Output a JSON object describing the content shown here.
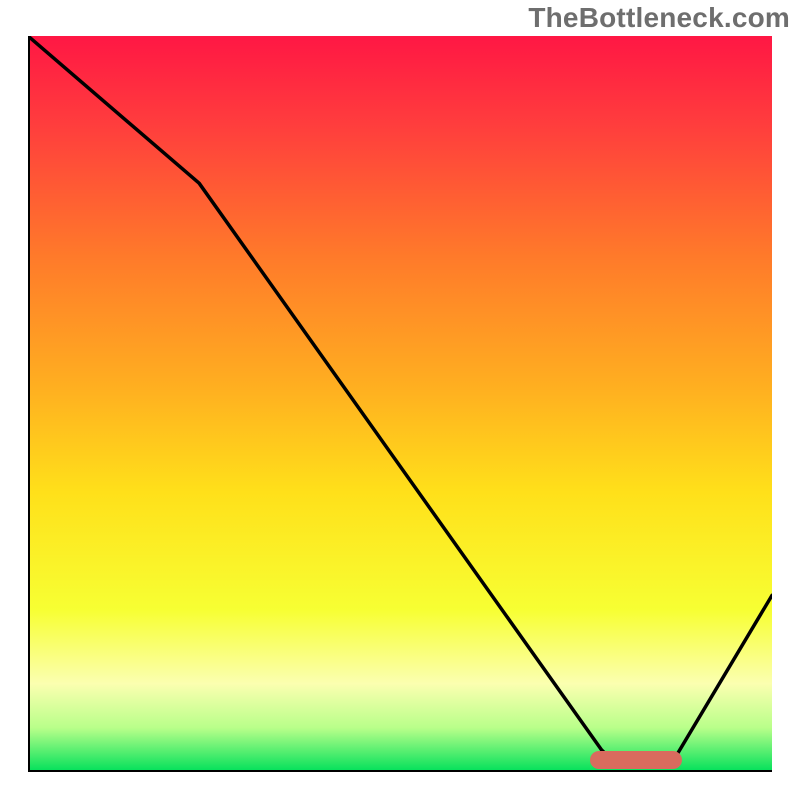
{
  "watermark": "TheBottleneck.com",
  "chart_data": {
    "type": "line",
    "title": "",
    "xlabel": "",
    "ylabel": "",
    "xlim": [
      0,
      100
    ],
    "ylim": [
      0,
      100
    ],
    "curve": {
      "x": [
        0,
        23,
        77,
        78,
        81,
        86,
        87,
        100
      ],
      "y": [
        100,
        80,
        3,
        2,
        1,
        1,
        2,
        24
      ]
    },
    "optimal_marker": {
      "x_range": [
        75.5,
        87.9
      ],
      "y": 1.4,
      "color": "#d96b5e"
    },
    "background_gradient": {
      "direction": "vertical",
      "stops": [
        {
          "pos": 0.0,
          "color": "#ff1744"
        },
        {
          "pos": 0.12,
          "color": "#ff3d3d"
        },
        {
          "pos": 0.3,
          "color": "#ff7a2a"
        },
        {
          "pos": 0.48,
          "color": "#ffb020"
        },
        {
          "pos": 0.62,
          "color": "#ffe01a"
        },
        {
          "pos": 0.78,
          "color": "#f7ff33"
        },
        {
          "pos": 0.88,
          "color": "#fbffb0"
        },
        {
          "pos": 0.94,
          "color": "#b9ff8a"
        },
        {
          "pos": 1.0,
          "color": "#00e05a"
        }
      ]
    }
  }
}
